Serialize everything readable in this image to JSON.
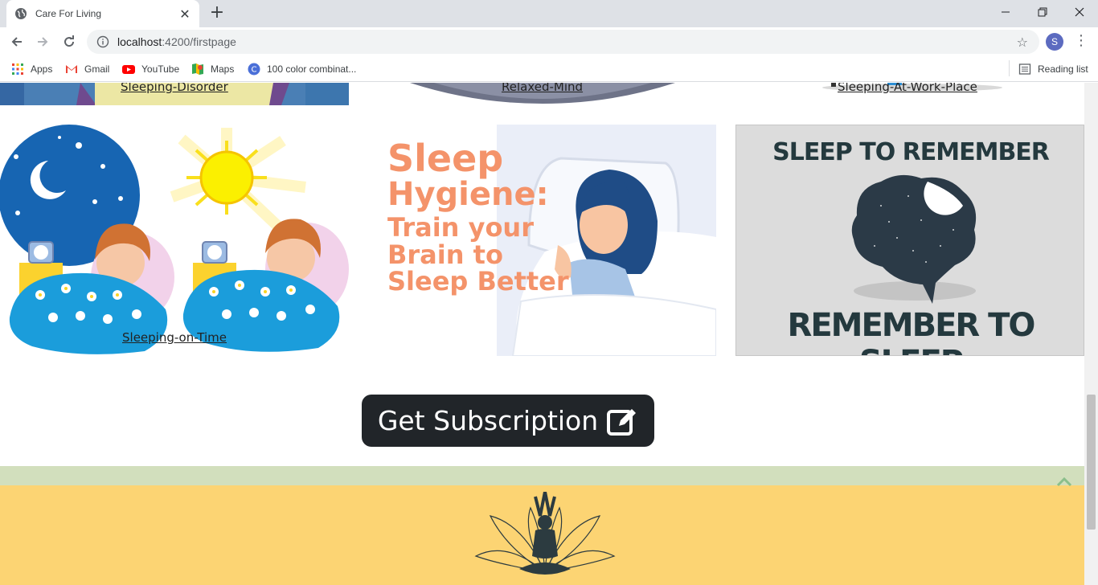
{
  "browser": {
    "tab_title": "Care For Living",
    "url_host": "localhost",
    "url_path": ":4200/firstpage",
    "profile_initial": "S",
    "bookmarks": [
      "Apps",
      "Gmail",
      "YouTube",
      "Maps",
      "100 color combinat..."
    ],
    "reading_list": "Reading list"
  },
  "cards_top": [
    "Sleeping-Disorder",
    "Relaxed-Mind",
    "Sleeping-At-Work-Place"
  ],
  "cards_row2": {
    "left_label": "Sleeping-on-Time",
    "middle": {
      "line1": "Sleep",
      "line2": "Hygiene:",
      "line3": "Train your",
      "line4": "Brain to",
      "line5": "Sleep Better"
    },
    "right": {
      "top": "SLEEP TO REMEMBER",
      "bottom": "REMEMBER TO SLEEP"
    }
  },
  "subscription_button": "Get Subscription",
  "colors": {
    "footer": "#fcd473",
    "band": "#d2dfbd",
    "button": "#212529",
    "sleep_text": "#f4936a"
  }
}
